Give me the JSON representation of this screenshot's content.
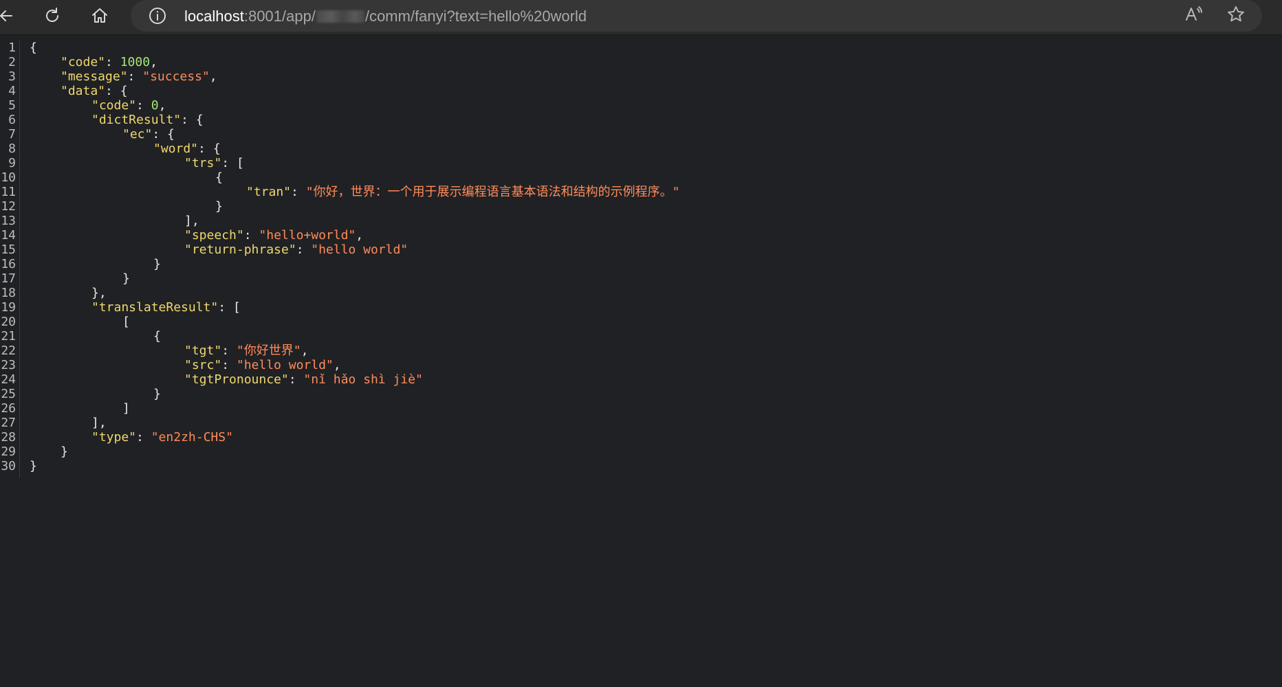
{
  "browser": {
    "url_host": "localhost",
    "url_rest_before": ":8001/app/",
    "url_rest_after": "/comm/fanyi?text=hello%20world",
    "read_aloud_label": "Aᵃ",
    "icons": {
      "back": "back-arrow-icon",
      "refresh": "refresh-icon",
      "home": "home-icon",
      "info": "info-icon",
      "read_aloud": "read-aloud-icon",
      "favorite": "star-icon"
    }
  },
  "colors": {
    "background": "#202124",
    "key": "#f0d86e",
    "string": "#ff8c5a",
    "number": "#a5e57a",
    "punct": "#e8e8e8"
  },
  "json_view": {
    "lines": [
      {
        "no": "1",
        "indent": 0,
        "tokens": [
          {
            "t": "p",
            "v": "{"
          }
        ]
      },
      {
        "no": "2",
        "indent": 1,
        "tokens": [
          {
            "t": "k",
            "v": "\"code\""
          },
          {
            "t": "p",
            "v": ": "
          },
          {
            "t": "n",
            "v": "1000"
          },
          {
            "t": "p",
            "v": ","
          }
        ]
      },
      {
        "no": "3",
        "indent": 1,
        "tokens": [
          {
            "t": "k",
            "v": "\"message\""
          },
          {
            "t": "p",
            "v": ": "
          },
          {
            "t": "s",
            "v": "\"success\""
          },
          {
            "t": "p",
            "v": ","
          }
        ]
      },
      {
        "no": "4",
        "indent": 1,
        "tokens": [
          {
            "t": "k",
            "v": "\"data\""
          },
          {
            "t": "p",
            "v": ": {"
          }
        ]
      },
      {
        "no": "5",
        "indent": 2,
        "tokens": [
          {
            "t": "k",
            "v": "\"code\""
          },
          {
            "t": "p",
            "v": ": "
          },
          {
            "t": "n",
            "v": "0"
          },
          {
            "t": "p",
            "v": ","
          }
        ]
      },
      {
        "no": "6",
        "indent": 2,
        "tokens": [
          {
            "t": "k",
            "v": "\"dictResult\""
          },
          {
            "t": "p",
            "v": ": {"
          }
        ]
      },
      {
        "no": "7",
        "indent": 3,
        "tokens": [
          {
            "t": "k",
            "v": "\"ec\""
          },
          {
            "t": "p",
            "v": ": {"
          }
        ]
      },
      {
        "no": "8",
        "indent": 4,
        "tokens": [
          {
            "t": "k",
            "v": "\"word\""
          },
          {
            "t": "p",
            "v": ": {"
          }
        ]
      },
      {
        "no": "9",
        "indent": 5,
        "tokens": [
          {
            "t": "k",
            "v": "\"trs\""
          },
          {
            "t": "p",
            "v": ": ["
          }
        ]
      },
      {
        "no": "10",
        "indent": 6,
        "tokens": [
          {
            "t": "p",
            "v": "{"
          }
        ]
      },
      {
        "no": "11",
        "indent": 7,
        "tokens": [
          {
            "t": "k",
            "v": "\"tran\""
          },
          {
            "t": "p",
            "v": ": "
          },
          {
            "t": "s",
            "v": "\"你好，世界：一个用于展示编程语言基本语法和结构的示例程序。\""
          }
        ]
      },
      {
        "no": "12",
        "indent": 6,
        "tokens": [
          {
            "t": "p",
            "v": "}"
          }
        ]
      },
      {
        "no": "13",
        "indent": 5,
        "tokens": [
          {
            "t": "p",
            "v": "],"
          }
        ]
      },
      {
        "no": "14",
        "indent": 5,
        "tokens": [
          {
            "t": "k",
            "v": "\"speech\""
          },
          {
            "t": "p",
            "v": ": "
          },
          {
            "t": "s",
            "v": "\"hello+world\""
          },
          {
            "t": "p",
            "v": ","
          }
        ]
      },
      {
        "no": "15",
        "indent": 5,
        "tokens": [
          {
            "t": "k",
            "v": "\"return-phrase\""
          },
          {
            "t": "p",
            "v": ": "
          },
          {
            "t": "s",
            "v": "\"hello world\""
          }
        ]
      },
      {
        "no": "16",
        "indent": 4,
        "tokens": [
          {
            "t": "p",
            "v": "}"
          }
        ]
      },
      {
        "no": "17",
        "indent": 3,
        "tokens": [
          {
            "t": "p",
            "v": "}"
          }
        ]
      },
      {
        "no": "18",
        "indent": 2,
        "tokens": [
          {
            "t": "p",
            "v": "},"
          }
        ]
      },
      {
        "no": "19",
        "indent": 2,
        "tokens": [
          {
            "t": "k",
            "v": "\"translateResult\""
          },
          {
            "t": "p",
            "v": ": ["
          }
        ]
      },
      {
        "no": "20",
        "indent": 3,
        "tokens": [
          {
            "t": "p",
            "v": "["
          }
        ]
      },
      {
        "no": "21",
        "indent": 4,
        "tokens": [
          {
            "t": "p",
            "v": "{"
          }
        ]
      },
      {
        "no": "22",
        "indent": 5,
        "tokens": [
          {
            "t": "k",
            "v": "\"tgt\""
          },
          {
            "t": "p",
            "v": ": "
          },
          {
            "t": "s",
            "v": "\"你好世界\""
          },
          {
            "t": "p",
            "v": ","
          }
        ]
      },
      {
        "no": "23",
        "indent": 5,
        "tokens": [
          {
            "t": "k",
            "v": "\"src\""
          },
          {
            "t": "p",
            "v": ": "
          },
          {
            "t": "s",
            "v": "\"hello world\""
          },
          {
            "t": "p",
            "v": ","
          }
        ]
      },
      {
        "no": "24",
        "indent": 5,
        "tokens": [
          {
            "t": "k",
            "v": "\"tgtPronounce\""
          },
          {
            "t": "p",
            "v": ": "
          },
          {
            "t": "s",
            "v": "\"nǐ hǎo shì jiè\""
          }
        ]
      },
      {
        "no": "25",
        "indent": 4,
        "tokens": [
          {
            "t": "p",
            "v": "}"
          }
        ]
      },
      {
        "no": "26",
        "indent": 3,
        "tokens": [
          {
            "t": "p",
            "v": "]"
          }
        ]
      },
      {
        "no": "27",
        "indent": 2,
        "tokens": [
          {
            "t": "p",
            "v": "],"
          }
        ]
      },
      {
        "no": "28",
        "indent": 2,
        "tokens": [
          {
            "t": "k",
            "v": "\"type\""
          },
          {
            "t": "p",
            "v": ": "
          },
          {
            "t": "s",
            "v": "\"en2zh-CHS\""
          }
        ]
      },
      {
        "no": "29",
        "indent": 1,
        "tokens": [
          {
            "t": "p",
            "v": "}"
          }
        ]
      },
      {
        "no": "30",
        "indent": 0,
        "tokens": [
          {
            "t": "p",
            "v": "}"
          }
        ]
      }
    ]
  }
}
